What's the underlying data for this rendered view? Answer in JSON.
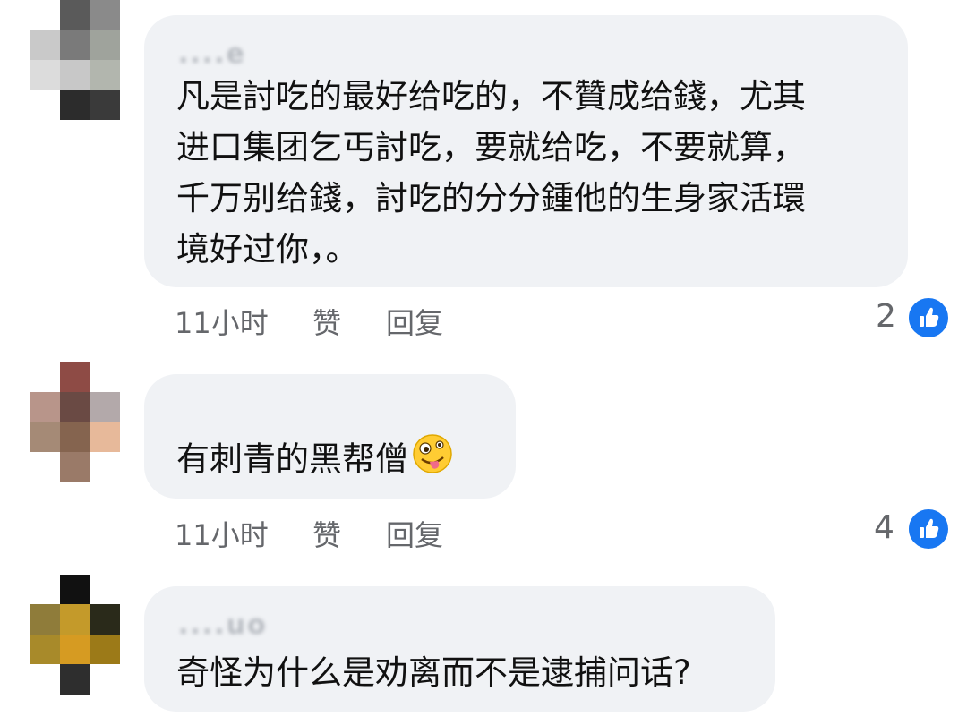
{
  "comments": [
    {
      "name": "....e",
      "lines": [
        "凡是討吃的最好给吃的，不贊成给錢，尤其",
        "进口集团乞丐討吃，要就给吃，不要就算，",
        "千万别给錢，討吃的分分鍾他的生身家活環",
        "境好过你，。"
      ],
      "time": "11小时",
      "like": "赞",
      "reply": "回复",
      "reactions": "2"
    },
    {
      "name": "",
      "lines": [
        "有刺青的黑帮僧"
      ],
      "emoji": "zany-face",
      "time": "11小时",
      "like": "赞",
      "reply": "回复",
      "reactions": "4"
    },
    {
      "name": "....uo",
      "lines": [
        "奇怪为什么是劝离而不是逮捕问话?"
      ]
    }
  ],
  "colors": {
    "bubble": "#f0f2f5",
    "like_blue": "#1877f2",
    "meta": "#65676b"
  }
}
